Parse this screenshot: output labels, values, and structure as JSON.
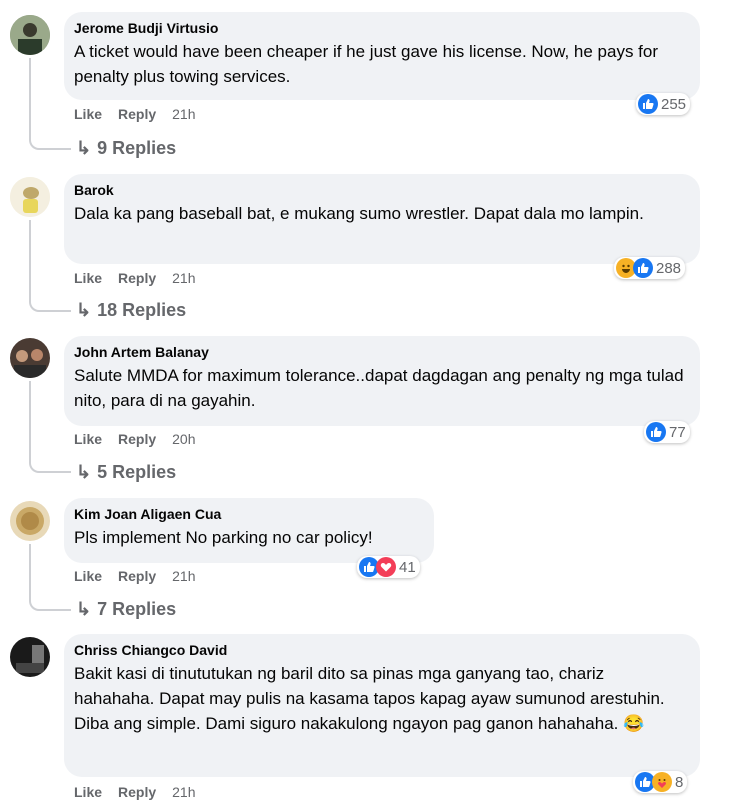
{
  "actions": {
    "like": "Like",
    "reply": "Reply"
  },
  "comments": [
    {
      "author": "Jerome Budji Virtusio",
      "text": "A ticket would have been cheaper if he just gave his license. Now, he pays for penalty plus towing services.",
      "time": "21h",
      "reactions": [
        "like-icon"
      ],
      "reaction_count": "255",
      "replies": "9 Replies"
    },
    {
      "author": "Barok",
      "text": "Dala ka pang baseball bat, e mukang sumo wrestler. Dapat dala mo lampin.",
      "time": "21h",
      "reactions": [
        "haha-icon",
        "like-icon"
      ],
      "reaction_count": "288",
      "replies": "18 Replies"
    },
    {
      "author": "John Artem Balanay",
      "text": "Salute MMDA for maximum tolerance..dapat dagdagan ang penalty ng mga tulad nito, para di na gayahin.",
      "time": "20h",
      "reactions": [
        "like-icon"
      ],
      "reaction_count": "77",
      "replies": "5 Replies"
    },
    {
      "author": "Kim Joan Aligaen Cua",
      "text": "Pls implement No parking no car policy!",
      "time": "21h",
      "reactions": [
        "like-icon",
        "love-icon"
      ],
      "reaction_count": "41",
      "replies": "7 Replies"
    },
    {
      "author": "Chriss Chiangco David",
      "text": "Bakit kasi di tinututukan ng baril dito sa pinas mga ganyang tao, chariz hahahaha. Dapat may pulis na kasama tapos kapag ayaw sumunod arestuhin. Diba ang simple. Dami siguro nakakulong ngayon pag ganon hahahaha. 😂",
      "time": "21h",
      "reactions": [
        "like-icon",
        "care-icon"
      ],
      "reaction_count": "8"
    }
  ],
  "colors": {
    "like": "#1877f2",
    "love": "#f33e58",
    "haha": "#f7b125",
    "bubble": "#f0f2f5",
    "meta": "#65676b"
  }
}
